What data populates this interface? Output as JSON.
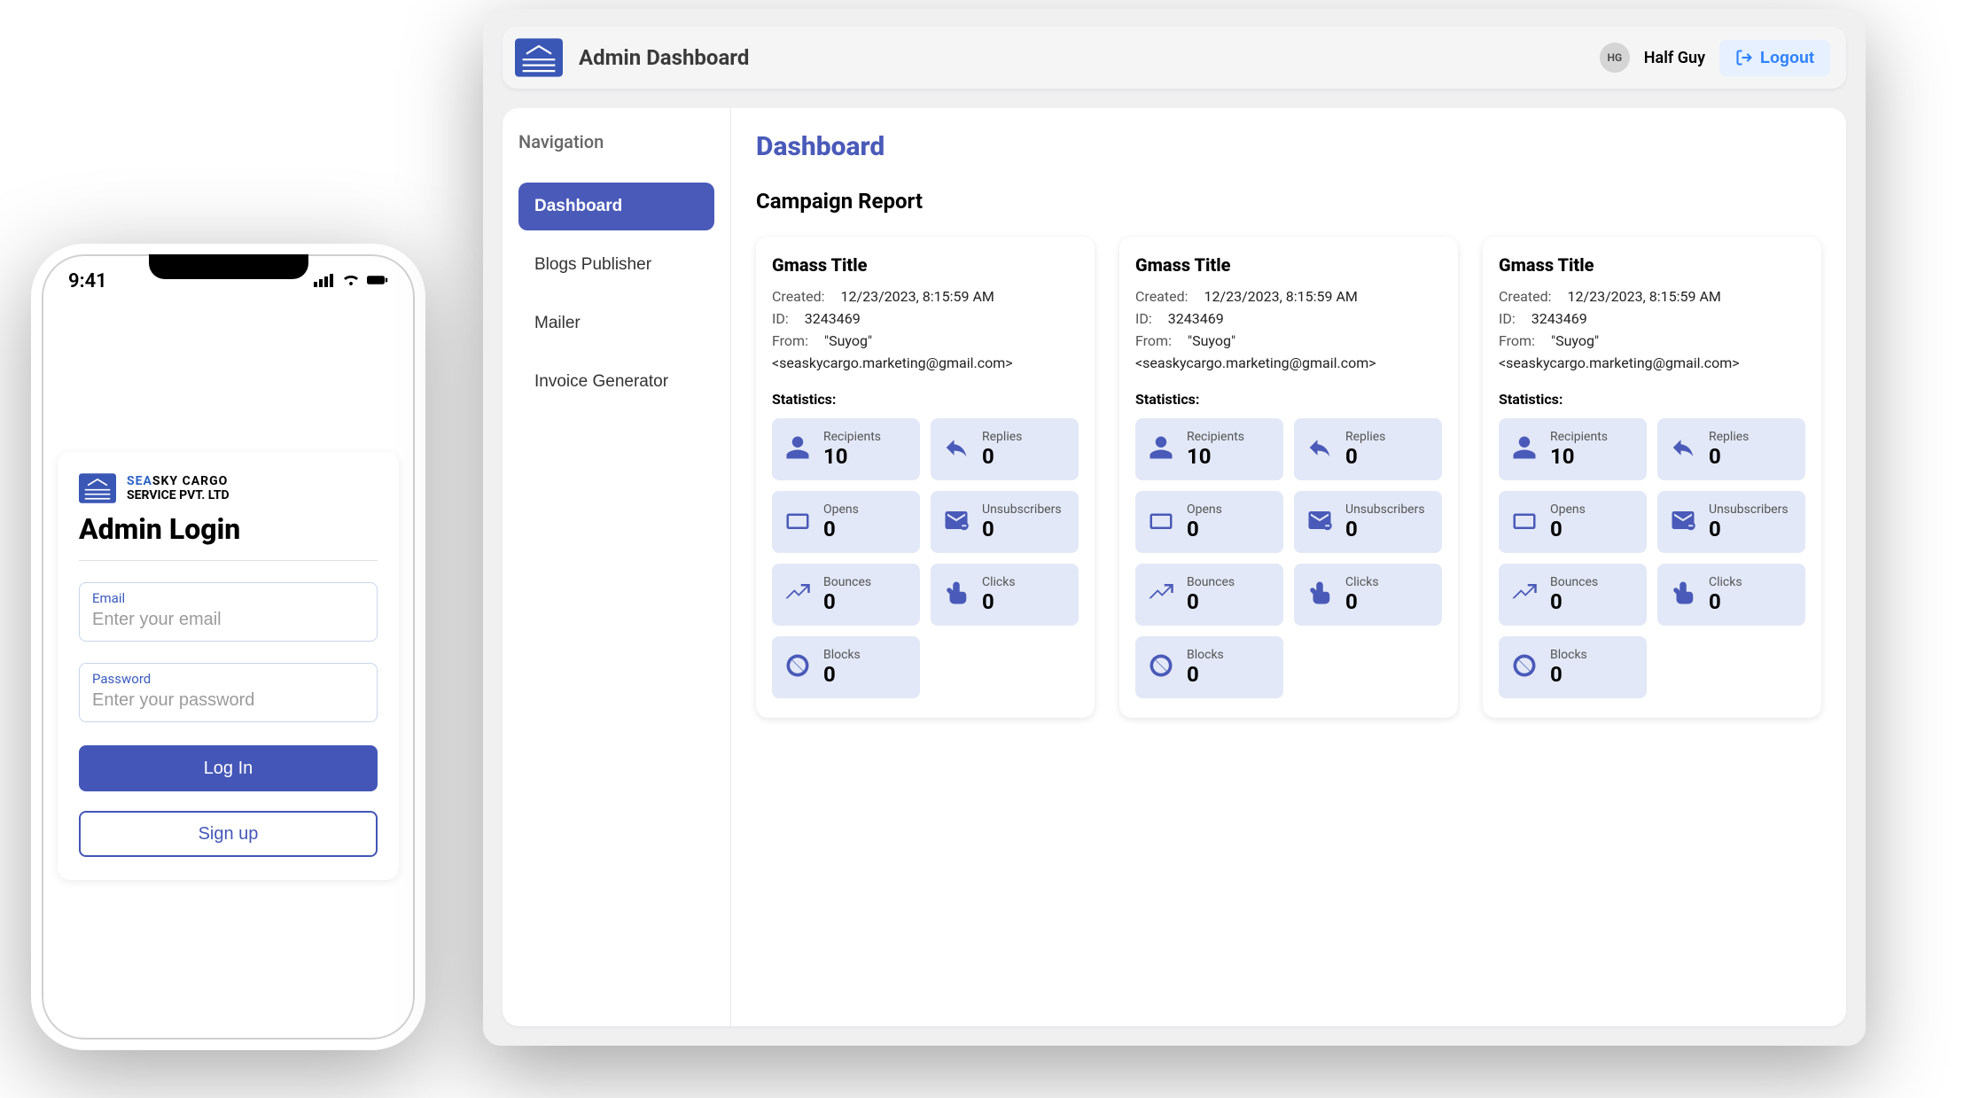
{
  "phone": {
    "time": "9:41",
    "brand_line1a": "SEA",
    "brand_line1b": "SKY CARGO",
    "brand_line2": "SERVICE PVT. LTD",
    "title": "Admin Login",
    "email_label": "Email",
    "email_placeholder": "Enter your email",
    "password_label": "Password",
    "password_placeholder": "Enter your password",
    "login_btn": "Log In",
    "signup_btn": "Sign up"
  },
  "desktop": {
    "title": "Admin Dashboard",
    "avatar_initials": "HG",
    "user_name": "Half Guy",
    "logout": "Logout",
    "sidebar": {
      "title": "Navigation",
      "items": [
        "Dashboard",
        "Blogs Publisher",
        "Mailer",
        "Invoice Generator"
      ]
    },
    "page_title": "Dashboard",
    "section_title": "Campaign Report",
    "cards": [
      {
        "title": "Gmass Title",
        "created_label": "Created:",
        "created_value": "12/23/2023, 8:15:59 AM",
        "id_label": "ID:",
        "id_value": "3243469",
        "from_label": "From:",
        "from_value": "\"Suyog\"",
        "from_email": "<seaskycargo.marketing@gmail.com>",
        "stats_title": "Statistics:",
        "stats": {
          "recipients_label": "Recipients",
          "recipients_value": "10",
          "replies_label": "Replies",
          "replies_value": "0",
          "opens_label": "Opens",
          "opens_value": "0",
          "unsub_label": "Unsubscribers",
          "unsub_value": "0",
          "bounces_label": "Bounces",
          "bounces_value": "0",
          "clicks_label": "Clicks",
          "clicks_value": "0",
          "blocks_label": "Blocks",
          "blocks_value": "0"
        }
      },
      {
        "title": "Gmass Title",
        "created_label": "Created:",
        "created_value": "12/23/2023, 8:15:59 AM",
        "id_label": "ID:",
        "id_value": "3243469",
        "from_label": "From:",
        "from_value": "\"Suyog\"",
        "from_email": "<seaskycargo.marketing@gmail.com>",
        "stats_title": "Statistics:",
        "stats": {
          "recipients_label": "Recipients",
          "recipients_value": "10",
          "replies_label": "Replies",
          "replies_value": "0",
          "opens_label": "Opens",
          "opens_value": "0",
          "unsub_label": "Unsubscribers",
          "unsub_value": "0",
          "bounces_label": "Bounces",
          "bounces_value": "0",
          "clicks_label": "Clicks",
          "clicks_value": "0",
          "blocks_label": "Blocks",
          "blocks_value": "0"
        }
      },
      {
        "title": "Gmass Title",
        "created_label": "Created:",
        "created_value": "12/23/2023, 8:15:59 AM",
        "id_label": "ID:",
        "id_value": "3243469",
        "from_label": "From:",
        "from_value": "\"Suyog\"",
        "from_email": "<seaskycargo.marketing@gmail.com>",
        "stats_title": "Statistics:",
        "stats": {
          "recipients_label": "Recipients",
          "recipients_value": "10",
          "replies_label": "Replies",
          "replies_value": "0",
          "opens_label": "Opens",
          "opens_value": "0",
          "unsub_label": "Unsubscribers",
          "unsub_value": "0",
          "bounces_label": "Bounces",
          "bounces_value": "0",
          "clicks_label": "Clicks",
          "clicks_value": "0",
          "blocks_label": "Blocks",
          "blocks_value": "0"
        }
      }
    ]
  }
}
